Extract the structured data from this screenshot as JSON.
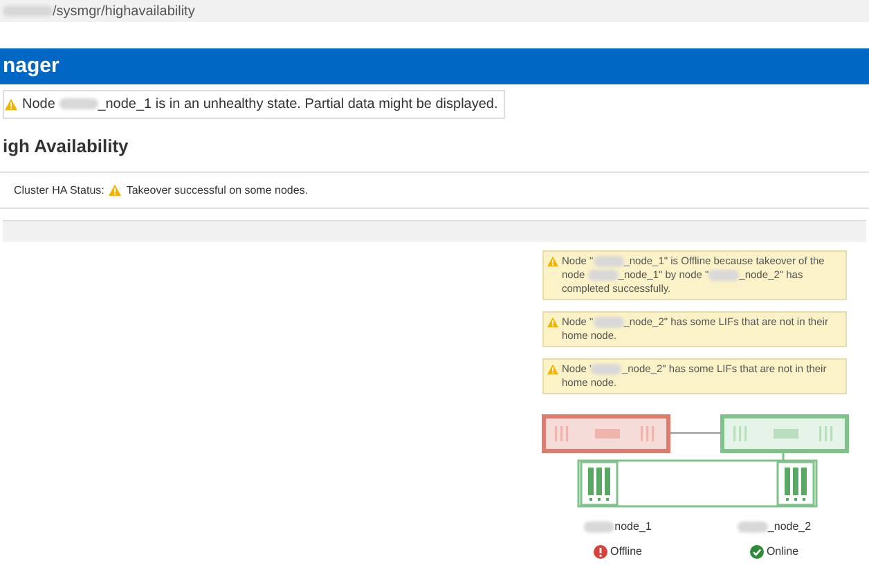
{
  "address_bar": {
    "url_parts": [
      "/sysmgr/highavailability"
    ]
  },
  "header": {
    "title": "nager"
  },
  "notice": {
    "parts": [
      "Node ",
      "_node_1 is in an unhealthy state. Partial data might be displayed."
    ]
  },
  "section": {
    "title": "igh Availability"
  },
  "ha_status": {
    "label": "Cluster HA Status:",
    "value": "Takeover successful on some nodes."
  },
  "alerts": [
    {
      "parts": [
        "Node \"",
        "_node_1\" is Offline because takeover of the node ",
        "_node_1\" by node \"",
        "_node_2\" has completed successfully."
      ]
    },
    {
      "parts": [
        "Node \"",
        "_node_2\" has some LIFs that are not in their home node."
      ]
    },
    {
      "parts": [
        "Node '",
        "_node_2\" has some LIFs that are not in their home node."
      ]
    }
  ],
  "nodes": [
    {
      "name": "node_1",
      "status": "Offline",
      "online": false
    },
    {
      "name": "_node_2",
      "status": "Online",
      "online": true
    }
  ]
}
